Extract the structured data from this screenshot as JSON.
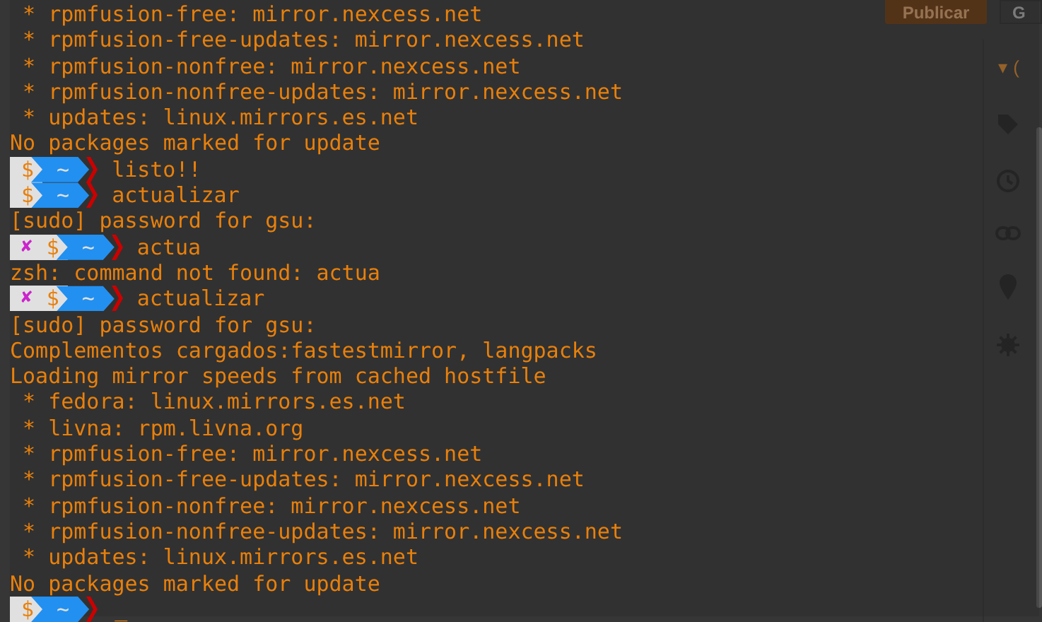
{
  "editor": {
    "publish_button": "Publicar",
    "second_button": "G",
    "sidebar_caret": "▾ ("
  },
  "terminal": {
    "lines": [
      {
        "kind": "text",
        "text": " * rpmfusion-free: mirror.nexcess.net"
      },
      {
        "kind": "text",
        "text": " * rpmfusion-free-updates: mirror.nexcess.net"
      },
      {
        "kind": "text",
        "text": " * rpmfusion-nonfree: mirror.nexcess.net"
      },
      {
        "kind": "text",
        "text": " * rpmfusion-nonfree-updates: mirror.nexcess.net"
      },
      {
        "kind": "text",
        "text": " * updates: linux.mirrors.es.net"
      },
      {
        "kind": "text",
        "text": "No packages marked for update"
      },
      {
        "kind": "prompt",
        "error": false,
        "symbol": "$",
        "dir": "~",
        "command": "listo!!"
      },
      {
        "kind": "prompt",
        "error": false,
        "symbol": "$",
        "dir": "~",
        "command": "actualizar"
      },
      {
        "kind": "text",
        "text": "[sudo] password for gsu:"
      },
      {
        "kind": "prompt",
        "error": true,
        "error_mark": "✘",
        "symbol": "$",
        "dir": "~",
        "command": "actua"
      },
      {
        "kind": "text",
        "text": "zsh: command not found: actua"
      },
      {
        "kind": "prompt",
        "error": true,
        "error_mark": "✘",
        "symbol": "$",
        "dir": "~",
        "command": "actualizar"
      },
      {
        "kind": "text",
        "text": "[sudo] password for gsu:"
      },
      {
        "kind": "text",
        "text": "Complementos cargados:fastestmirror, langpacks"
      },
      {
        "kind": "text",
        "text": "Loading mirror speeds from cached hostfile"
      },
      {
        "kind": "text",
        "text": " * fedora: linux.mirrors.es.net"
      },
      {
        "kind": "text",
        "text": " * livna: rpm.livna.org"
      },
      {
        "kind": "text",
        "text": " * rpmfusion-free: mirror.nexcess.net"
      },
      {
        "kind": "text",
        "text": " * rpmfusion-free-updates: mirror.nexcess.net"
      },
      {
        "kind": "text",
        "text": " * rpmfusion-nonfree: mirror.nexcess.net"
      },
      {
        "kind": "text",
        "text": " * rpmfusion-nonfree-updates: mirror.nexcess.net"
      },
      {
        "kind": "text",
        "text": " * updates: linux.mirrors.es.net"
      },
      {
        "kind": "text",
        "text": "No packages marked for update"
      },
      {
        "kind": "prompt",
        "error": false,
        "symbol": "$",
        "dir": "~",
        "cursor": "_"
      }
    ]
  }
}
